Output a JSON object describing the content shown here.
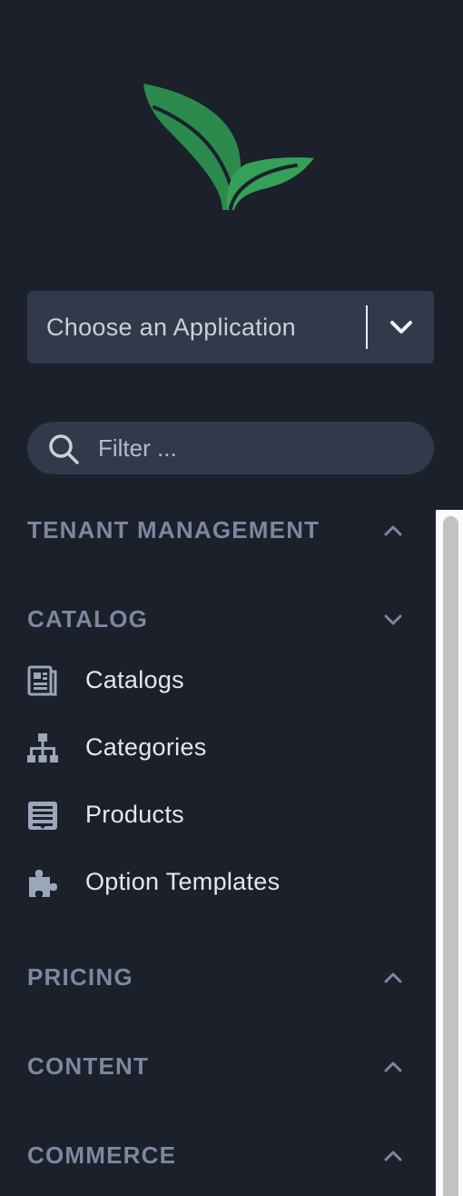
{
  "app_selector": {
    "label": "Choose an Application"
  },
  "filter": {
    "placeholder": "Filter ..."
  },
  "sections": {
    "tenant_management": {
      "title": "TENANT MANAGEMENT",
      "state": "collapsed"
    },
    "catalog": {
      "title": "CATALOG",
      "state": "expanded"
    },
    "pricing": {
      "title": "PRICING",
      "state": "collapsed"
    },
    "content": {
      "title": "CONTENT",
      "state": "collapsed"
    },
    "commerce": {
      "title": "COMMERCE",
      "state": "collapsed"
    }
  },
  "catalog_items": [
    {
      "label": "Catalogs",
      "icon": "catalog-icon"
    },
    {
      "label": "Categories",
      "icon": "sitemap-icon"
    },
    {
      "label": "Products",
      "icon": "product-icon"
    },
    {
      "label": "Option Templates",
      "icon": "puzzle-icon"
    }
  ],
  "colors": {
    "background": "#1b202b",
    "input_background": "#313a4a",
    "section_title": "#7b889f",
    "item_text": "#e4e8ee",
    "icon": "#9aa6b9",
    "logo_green": "#2f8f4e"
  }
}
